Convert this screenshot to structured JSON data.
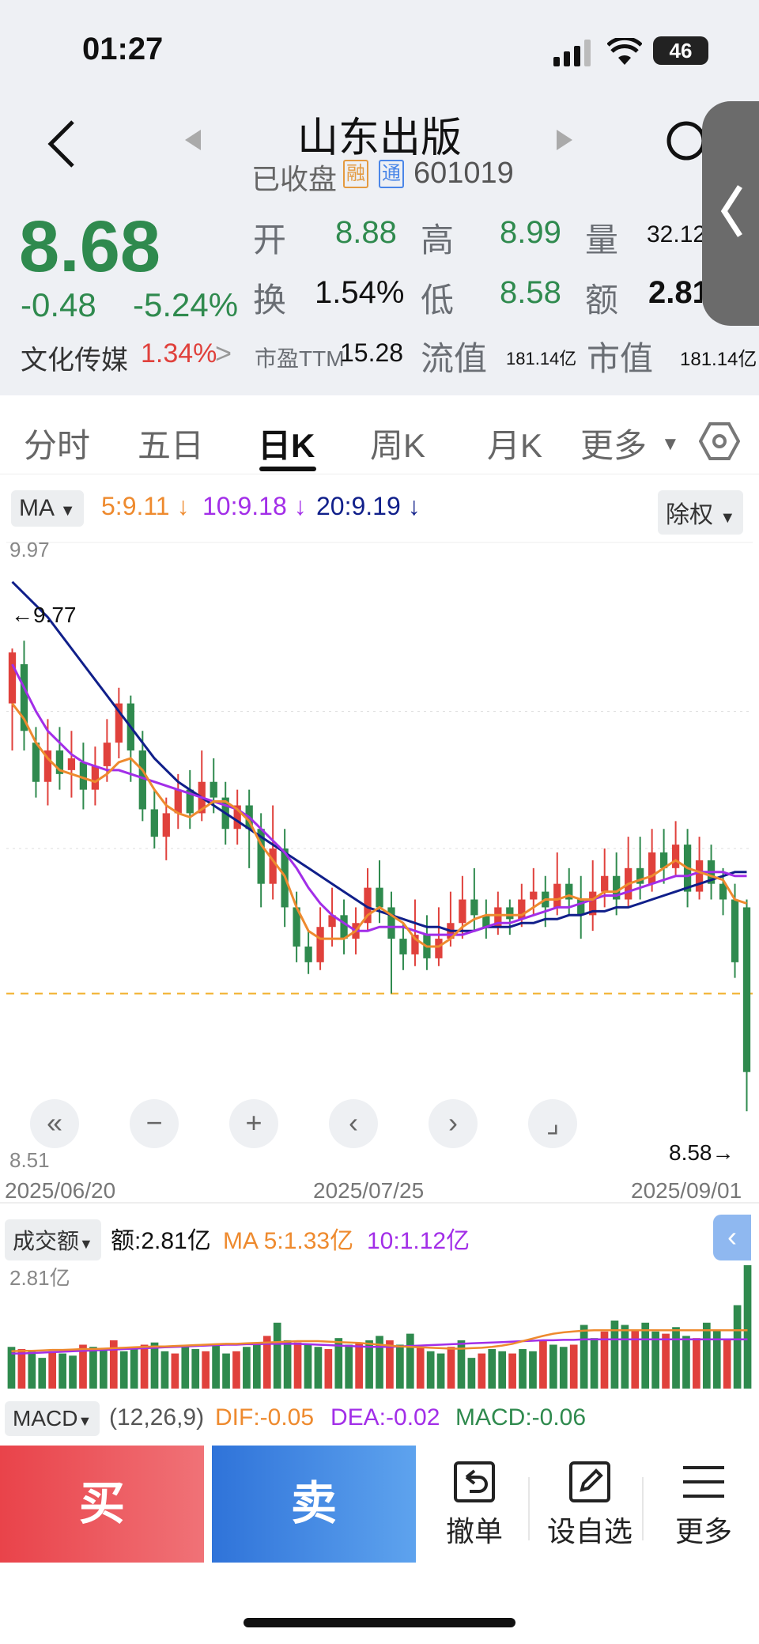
{
  "status_bar": {
    "time": "01:27",
    "battery": "46"
  },
  "header": {
    "title": "山东出版",
    "subtitle_status": "已收盘",
    "tag_rong": "融",
    "tag_tong": "通",
    "code": "601019"
  },
  "quote": {
    "price": "8.68",
    "change": "-0.48",
    "change_pct": "-5.24%",
    "sector_name": "文化传媒",
    "sector_pct": "1.34%",
    "open_label": "开",
    "open": "8.88",
    "high_label": "高",
    "high": "8.99",
    "vol_label": "量",
    "vol": "32.12",
    "turnover_label": "换",
    "turnover": "1.54%",
    "low_label": "低",
    "low": "8.58",
    "amount_label": "额",
    "amount": "2.81",
    "pe_label": "市盈TTM",
    "pe": "15.28",
    "float_label": "流值",
    "float_cap": "181.14亿",
    "mcap_label": "市值",
    "mcap": "181.14亿"
  },
  "tabs": [
    "分时",
    "五日",
    "日K",
    "周K",
    "月K",
    "更多"
  ],
  "indicator": {
    "ma_selector": "MA",
    "ma5": "5:9.11",
    "ma10": "10:9.18",
    "ma20": "20:9.19",
    "adjust": "除权"
  },
  "chart_labels": {
    "y_top": "9.97",
    "y_bottom": "8.51",
    "max_marker": "9.77",
    "min_marker": "8.58",
    "date_start": "2025/06/20",
    "date_mid": "2025/07/25",
    "date_end": "2025/09/01"
  },
  "volume_panel": {
    "selector": "成交额",
    "amount": "额:2.81亿",
    "ma5": "MA 5:1.33亿",
    "ma10": "10:1.12亿",
    "y_top": "2.81亿"
  },
  "macd_panel": {
    "selector": "MACD",
    "params": "(12,26,9)",
    "dif": "DIF:-0.05",
    "dea": "DEA:-0.02",
    "macd": "MACD:-0.06"
  },
  "actions": {
    "buy": "买",
    "sell": "卖",
    "cancel": "撤单",
    "watchlist": "设自选",
    "more": "更多"
  },
  "colors": {
    "up": "#e0413c",
    "down": "#2f8a4e",
    "ma5": "#ee8a2e",
    "ma10": "#a22ee8",
    "ma20": "#101f8a"
  },
  "chart_data": {
    "type": "candlestick",
    "y_range": [
      8.51,
      9.97
    ],
    "x_start": "2025/06/20",
    "x_end": "2025/09/01",
    "candles": [
      [
        9.62,
        9.75,
        9.76,
        9.5
      ],
      [
        9.72,
        9.55,
        9.78,
        9.5
      ],
      [
        9.52,
        9.42,
        9.56,
        9.38
      ],
      [
        9.42,
        9.5,
        9.58,
        9.36
      ],
      [
        9.5,
        9.44,
        9.56,
        9.4
      ],
      [
        9.45,
        9.48,
        9.55,
        9.38
      ],
      [
        9.47,
        9.4,
        9.52,
        9.35
      ],
      [
        9.4,
        9.46,
        9.51,
        9.36
      ],
      [
        9.46,
        9.52,
        9.58,
        9.42
      ],
      [
        9.52,
        9.62,
        9.66,
        9.48
      ],
      [
        9.62,
        9.5,
        9.64,
        9.42
      ],
      [
        9.5,
        9.35,
        9.55,
        9.32
      ],
      [
        9.35,
        9.28,
        9.4,
        9.25
      ],
      [
        9.28,
        9.34,
        9.38,
        9.22
      ],
      [
        9.34,
        9.4,
        9.44,
        9.3
      ],
      [
        9.4,
        9.34,
        9.45,
        9.3
      ],
      [
        9.34,
        9.42,
        9.5,
        9.32
      ],
      [
        9.42,
        9.38,
        9.48,
        9.34
      ],
      [
        9.38,
        9.3,
        9.42,
        9.26
      ],
      [
        9.3,
        9.36,
        9.4,
        9.26
      ],
      [
        9.36,
        9.3,
        9.4,
        9.2
      ],
      [
        9.3,
        9.16,
        9.34,
        9.1
      ],
      [
        9.16,
        9.25,
        9.36,
        9.12
      ],
      [
        9.25,
        9.1,
        9.3,
        9.05
      ],
      [
        9.1,
        9.0,
        9.14,
        8.96
      ],
      [
        9.0,
        8.96,
        9.04,
        8.93
      ],
      [
        8.96,
        9.05,
        9.1,
        8.94
      ],
      [
        9.05,
        9.08,
        9.15,
        9.0
      ],
      [
        9.08,
        9.02,
        9.12,
        8.98
      ],
      [
        9.02,
        9.06,
        9.1,
        8.98
      ],
      [
        9.06,
        9.15,
        9.2,
        9.04
      ],
      [
        9.15,
        9.1,
        9.22,
        9.06
      ],
      [
        9.1,
        9.02,
        9.14,
        8.88
      ],
      [
        9.02,
        8.98,
        9.06,
        8.94
      ],
      [
        8.98,
        9.03,
        9.12,
        8.95
      ],
      [
        9.03,
        8.97,
        9.08,
        8.94
      ],
      [
        8.97,
        9.02,
        9.1,
        8.95
      ],
      [
        9.02,
        9.06,
        9.14,
        9.0
      ],
      [
        9.06,
        9.12,
        9.18,
        9.02
      ],
      [
        9.12,
        9.08,
        9.2,
        9.04
      ],
      [
        9.08,
        9.05,
        9.12,
        9.02
      ],
      [
        9.05,
        9.1,
        9.14,
        9.03
      ],
      [
        9.1,
        9.07,
        9.12,
        9.03
      ],
      [
        9.07,
        9.12,
        9.16,
        9.05
      ],
      [
        9.12,
        9.14,
        9.2,
        9.08
      ],
      [
        9.14,
        9.1,
        9.18,
        9.05
      ],
      [
        9.1,
        9.16,
        9.24,
        9.08
      ],
      [
        9.16,
        9.12,
        9.2,
        9.08
      ],
      [
        9.12,
        9.08,
        9.18,
        9.02
      ],
      [
        9.08,
        9.14,
        9.22,
        9.04
      ],
      [
        9.14,
        9.18,
        9.25,
        9.1
      ],
      [
        9.18,
        9.12,
        9.24,
        9.08
      ],
      [
        9.12,
        9.2,
        9.28,
        9.1
      ],
      [
        9.2,
        9.16,
        9.28,
        9.12
      ],
      [
        9.16,
        9.24,
        9.3,
        9.14
      ],
      [
        9.24,
        9.2,
        9.3,
        9.16
      ],
      [
        9.2,
        9.26,
        9.32,
        9.18
      ],
      [
        9.26,
        9.14,
        9.3,
        9.1
      ],
      [
        9.14,
        9.22,
        9.28,
        9.12
      ],
      [
        9.22,
        9.16,
        9.26,
        9.12
      ],
      [
        9.16,
        9.12,
        9.2,
        9.08
      ],
      [
        9.12,
        8.96,
        9.16,
        8.92
      ],
      [
        9.1,
        8.68,
        9.12,
        8.58
      ]
    ],
    "ma5": [
      9.62,
      9.58,
      9.52,
      9.48,
      9.45,
      9.44,
      9.43,
      9.42,
      9.44,
      9.47,
      9.48,
      9.45,
      9.4,
      9.36,
      9.34,
      9.33,
      9.35,
      9.37,
      9.37,
      9.35,
      9.32,
      9.26,
      9.22,
      9.18,
      9.1,
      9.04,
      9.02,
      9.02,
      9.02,
      9.04,
      9.08,
      9.1,
      9.08,
      9.06,
      9.02,
      9.0,
      9.0,
      9.02,
      9.05,
      9.07,
      9.08,
      9.08,
      9.08,
      9.08,
      9.1,
      9.12,
      9.12,
      9.13,
      9.12,
      9.12,
      9.14,
      9.14,
      9.16,
      9.17,
      9.18,
      9.2,
      9.22,
      9.2,
      9.19,
      9.18,
      9.17,
      9.12,
      9.11
    ],
    "ma10": [
      9.72,
      9.66,
      9.6,
      9.55,
      9.52,
      9.49,
      9.47,
      9.46,
      9.45,
      9.45,
      9.44,
      9.43,
      9.42,
      9.41,
      9.4,
      9.39,
      9.38,
      9.37,
      9.36,
      9.35,
      9.33,
      9.3,
      9.27,
      9.24,
      9.2,
      9.15,
      9.11,
      9.08,
      9.06,
      9.04,
      9.04,
      9.05,
      9.05,
      9.05,
      9.04,
      9.03,
      9.03,
      9.03,
      9.03,
      9.04,
      9.05,
      9.06,
      9.06,
      9.07,
      9.08,
      9.09,
      9.1,
      9.1,
      9.11,
      9.12,
      9.13,
      9.13,
      9.14,
      9.15,
      9.16,
      9.17,
      9.18,
      9.18,
      9.19,
      9.19,
      9.19,
      9.18,
      9.18
    ],
    "ma20": [
      9.93,
      9.9,
      9.87,
      9.84,
      9.8,
      9.76,
      9.72,
      9.68,
      9.64,
      9.6,
      9.56,
      9.52,
      9.48,
      9.45,
      9.42,
      9.4,
      9.38,
      9.36,
      9.34,
      9.32,
      9.3,
      9.28,
      9.26,
      9.24,
      9.22,
      9.2,
      9.18,
      9.16,
      9.14,
      9.12,
      9.1,
      9.09,
      9.08,
      9.07,
      9.06,
      9.05,
      9.05,
      9.04,
      9.04,
      9.04,
      9.05,
      9.05,
      9.05,
      9.06,
      9.06,
      9.07,
      9.07,
      9.08,
      9.08,
      9.09,
      9.09,
      9.1,
      9.1,
      9.11,
      9.12,
      9.13,
      9.14,
      9.15,
      9.16,
      9.17,
      9.18,
      9.19,
      9.19
    ],
    "volume_range": [
      0,
      2.81
    ],
    "volume": [
      0.95,
      0.9,
      0.85,
      0.7,
      0.85,
      0.8,
      0.75,
      1.0,
      0.95,
      0.9,
      1.1,
      0.85,
      0.9,
      1.0,
      1.05,
      0.85,
      0.8,
      0.95,
      0.9,
      0.85,
      1.0,
      0.8,
      0.85,
      0.95,
      1.0,
      1.2,
      1.5,
      1.1,
      1.05,
      1.0,
      0.95,
      0.9,
      1.15,
      1.0,
      1.05,
      1.1,
      1.2,
      1.1,
      1.0,
      1.25,
      0.95,
      0.85,
      0.8,
      0.95,
      1.1,
      0.7,
      0.8,
      0.9,
      0.85,
      0.8,
      0.9,
      0.85,
      1.1,
      1.0,
      0.95,
      1.0,
      1.45,
      1.15,
      1.3,
      1.55,
      1.45,
      1.35,
      1.5,
      1.3,
      1.25,
      1.4,
      1.2,
      1.15,
      1.5,
      1.35,
      1.1,
      1.9,
      2.81
    ],
    "vol_ma5": [
      0.85,
      0.86,
      0.86,
      0.87,
      0.88,
      0.88,
      0.89,
      0.9,
      0.9,
      0.91,
      0.92,
      0.93,
      0.94,
      0.95,
      0.96,
      0.96,
      0.97,
      0.98,
      0.99,
      1.0,
      1.01,
      1.02,
      1.02,
      1.03,
      1.04,
      1.05,
      1.06,
      1.07,
      1.08,
      1.08,
      1.08,
      1.07,
      1.06,
      1.05,
      1.04,
      1.02,
      1.0,
      0.98,
      0.96,
      0.95,
      0.94,
      0.93,
      0.92,
      0.91,
      0.91,
      0.92,
      0.93,
      0.95,
      0.98,
      1.02,
      1.08,
      1.14,
      1.2,
      1.25,
      1.28,
      1.3,
      1.32,
      1.33,
      1.33,
      1.33,
      1.33,
      1.33,
      1.33,
      1.33,
      1.33,
      1.33,
      1.33,
      1.33,
      1.33,
      1.33,
      1.33,
      1.33,
      1.33
    ],
    "vol_ma10": [
      0.8,
      0.8,
      0.81,
      0.82,
      0.83,
      0.84,
      0.85,
      0.86,
      0.87,
      0.88,
      0.89,
      0.9,
      0.91,
      0.92,
      0.93,
      0.94,
      0.95,
      0.96,
      0.97,
      0.98,
      0.99,
      1.0,
      1.0,
      1.01,
      1.01,
      1.02,
      1.02,
      1.02,
      1.02,
      1.01,
      1.0,
      0.99,
      0.98,
      0.97,
      0.96,
      0.95,
      0.95,
      0.95,
      0.96,
      0.97,
      0.98,
      0.99,
      1.0,
      1.01,
      1.02,
      1.03,
      1.04,
      1.05,
      1.06,
      1.07,
      1.08,
      1.09,
      1.1,
      1.1,
      1.11,
      1.11,
      1.12,
      1.12,
      1.12,
      1.12,
      1.12,
      1.12,
      1.12,
      1.12,
      1.12,
      1.12,
      1.12,
      1.12,
      1.12,
      1.12,
      1.12,
      1.12,
      1.12
    ]
  }
}
